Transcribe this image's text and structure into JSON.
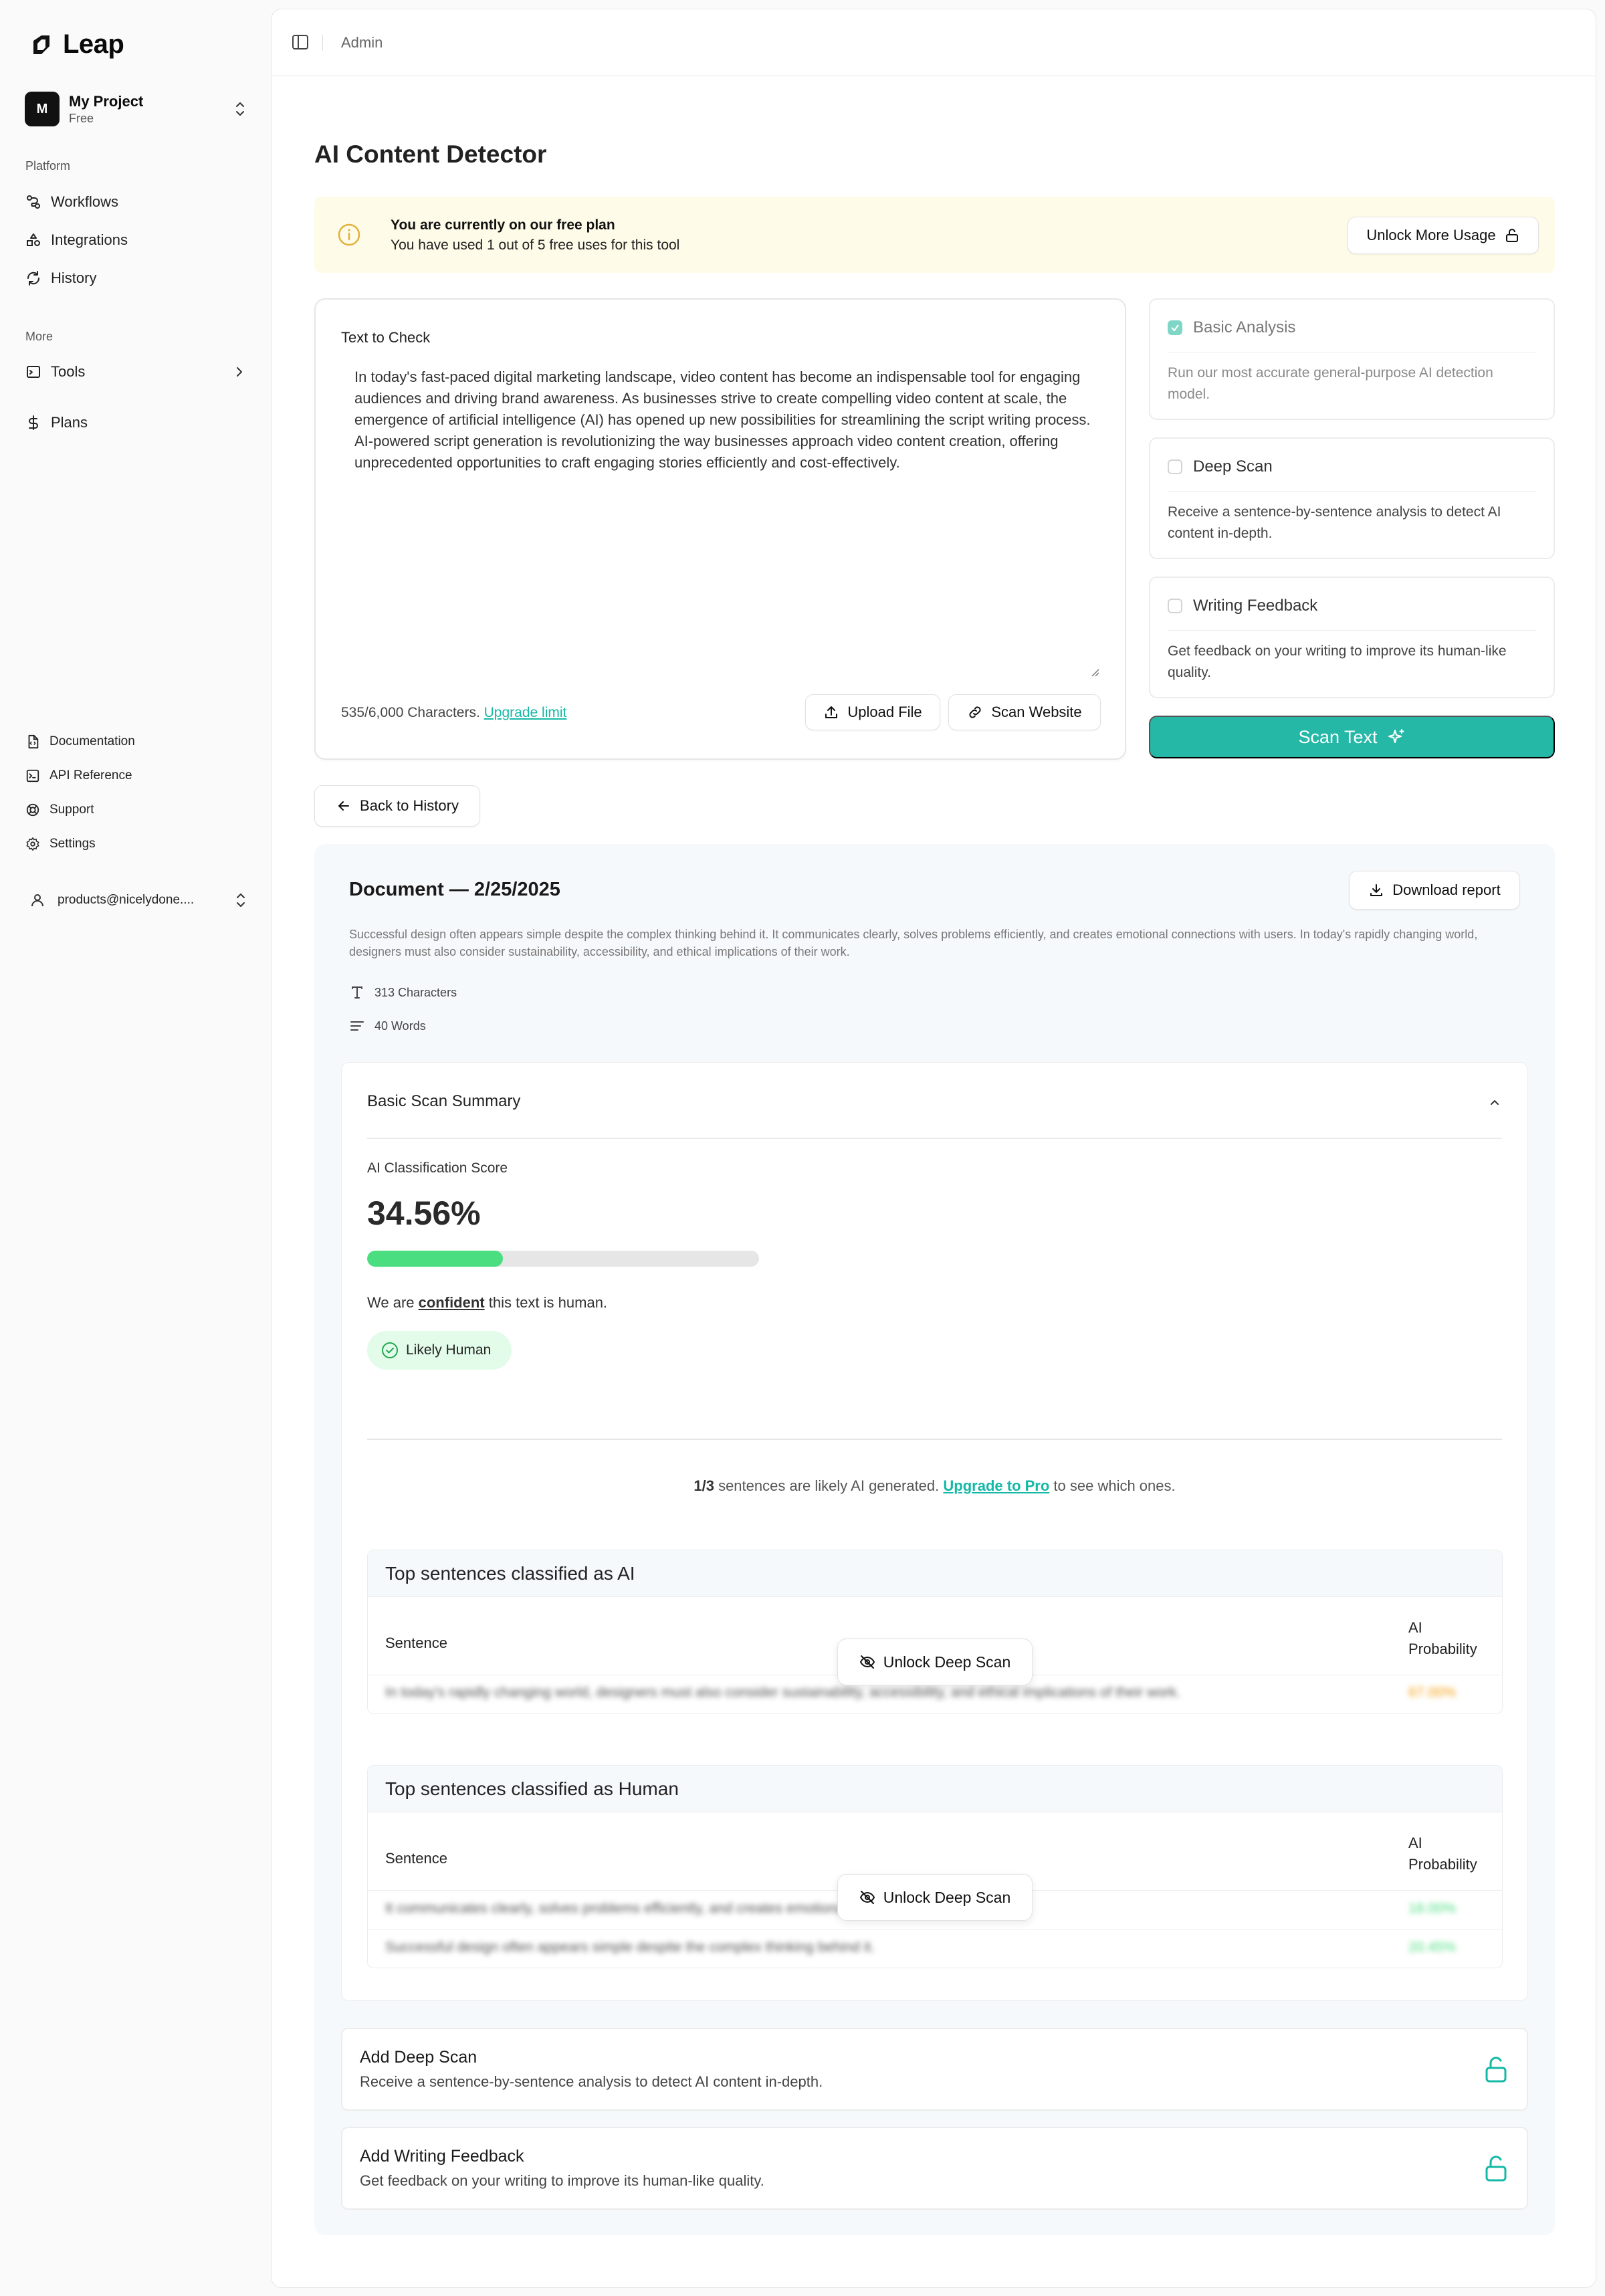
{
  "app": {
    "logo_text": "Leap"
  },
  "project": {
    "initial": "M",
    "name": "My Project",
    "plan": "Free"
  },
  "sidebar": {
    "platform_label": "Platform",
    "platform_items": [
      {
        "label": "Workflows",
        "icon": "workflow-icon"
      },
      {
        "label": "Integrations",
        "icon": "shapes-icon"
      },
      {
        "label": "History",
        "icon": "refresh-icon"
      }
    ],
    "more_label": "More",
    "more_items": [
      {
        "label": "Tools",
        "icon": "terminal-icon"
      },
      {
        "label": "Plans",
        "icon": "dollar-icon"
      }
    ],
    "footer_items": [
      {
        "label": "Documentation",
        "icon": "file-code-icon"
      },
      {
        "label": "API Reference",
        "icon": "terminal-square-icon"
      },
      {
        "label": "Support",
        "icon": "lifebuoy-icon"
      },
      {
        "label": "Settings",
        "icon": "gear-icon"
      }
    ],
    "user_email": "products@nicelydone...."
  },
  "topbar": {
    "breadcrumb": "Admin"
  },
  "page": {
    "title": "AI Content Detector"
  },
  "banner": {
    "line1": "You are currently on our free plan",
    "line2": "You have used 1 out of 5 free uses for this tool",
    "button": "Unlock More Usage"
  },
  "text_input": {
    "label": "Text to Check",
    "value": "In today's fast-paced digital marketing landscape, video content has become an indispensable tool for engaging audiences and driving brand awareness. As businesses strive to create compelling video content at scale, the emergence of artificial intelligence (AI) has opened up new possibilities for streamlining the script writing process. AI-powered script generation is revolutionizing the way businesses approach video content creation, offering unprecedented opportunities to craft engaging stories efficiently and cost-effectively.",
    "char_count": "535/6,000 Characters.",
    "upgrade_link": "Upgrade limit",
    "upload_button": "Upload File",
    "scan_website_button": "Scan Website"
  },
  "options": [
    {
      "title": "Basic Analysis",
      "desc": "Run our most accurate general-purpose AI detection model.",
      "checked": true
    },
    {
      "title": "Deep Scan",
      "desc": "Receive a sentence-by-sentence analysis to detect AI content in-depth.",
      "checked": false
    },
    {
      "title": "Writing Feedback",
      "desc": "Get feedback on your writing to improve its human-like quality.",
      "checked": false
    }
  ],
  "scan_button": "Scan Text",
  "back_button": "Back to History",
  "result": {
    "doc_title": "Document — 2/25/2025",
    "download_button": "Download report",
    "doc_desc": "Successful design often appears simple despite the complex thinking behind it. It communicates clearly, solves problems efficiently, and creates emotional connections with users. In today's rapidly changing world, designers must also consider sustainability, accessibility, and ethical implications of their work.",
    "characters": "313 Characters",
    "words": "40 Words",
    "summary": {
      "title": "Basic Scan Summary",
      "score_label": "AI Classification Score",
      "score": "34.56%",
      "score_fraction": 0.3456,
      "conf_prefix": "We are ",
      "conf_word": "confident",
      "conf_suffix": " this text is human.",
      "badge": "Likely Human",
      "ratio_bold": "1/3",
      "ratio_mid": " sentences are likely AI generated. ",
      "ratio_link": "Upgrade to Pro",
      "ratio_end": " to see which ones."
    },
    "ai_table": {
      "title": "Top sentences classified as AI",
      "col_sentence": "Sentence",
      "col_prob_1": "AI",
      "col_prob_2": "Probability",
      "unlock": "Unlock Deep Scan",
      "rows": [
        {
          "text": "In today's rapidly changing world, designers must also consider sustainability, accessibility, and ethical implications of their work.",
          "prob": "67.00%",
          "color": "#f59e0b"
        }
      ]
    },
    "human_table": {
      "title": "Top sentences classified as Human",
      "col_sentence": "Sentence",
      "col_prob_1": "AI",
      "col_prob_2": "Probability",
      "unlock": "Unlock Deep Scan",
      "rows": [
        {
          "text": "It communicates clearly, solves problems efficiently, and creates emotional connections with users.",
          "prob": "18.00%",
          "color": "#4ade80"
        },
        {
          "text": "Successful design often appears simple despite the complex thinking behind it.",
          "prob": "20.45%",
          "color": "#4ade80"
        }
      ]
    },
    "addons": [
      {
        "title": "Add Deep Scan",
        "desc": "Receive a sentence-by-sentence analysis to detect AI content in-depth."
      },
      {
        "title": "Add Writing Feedback",
        "desc": "Get feedback on your writing to improve its human-like quality."
      }
    ]
  },
  "colors": {
    "accent": "#26b8a7",
    "link": "#14b8a6",
    "progress": "#4ade80",
    "banner_bg": "#fefbe8",
    "badge_bg": "#e3fcea"
  }
}
